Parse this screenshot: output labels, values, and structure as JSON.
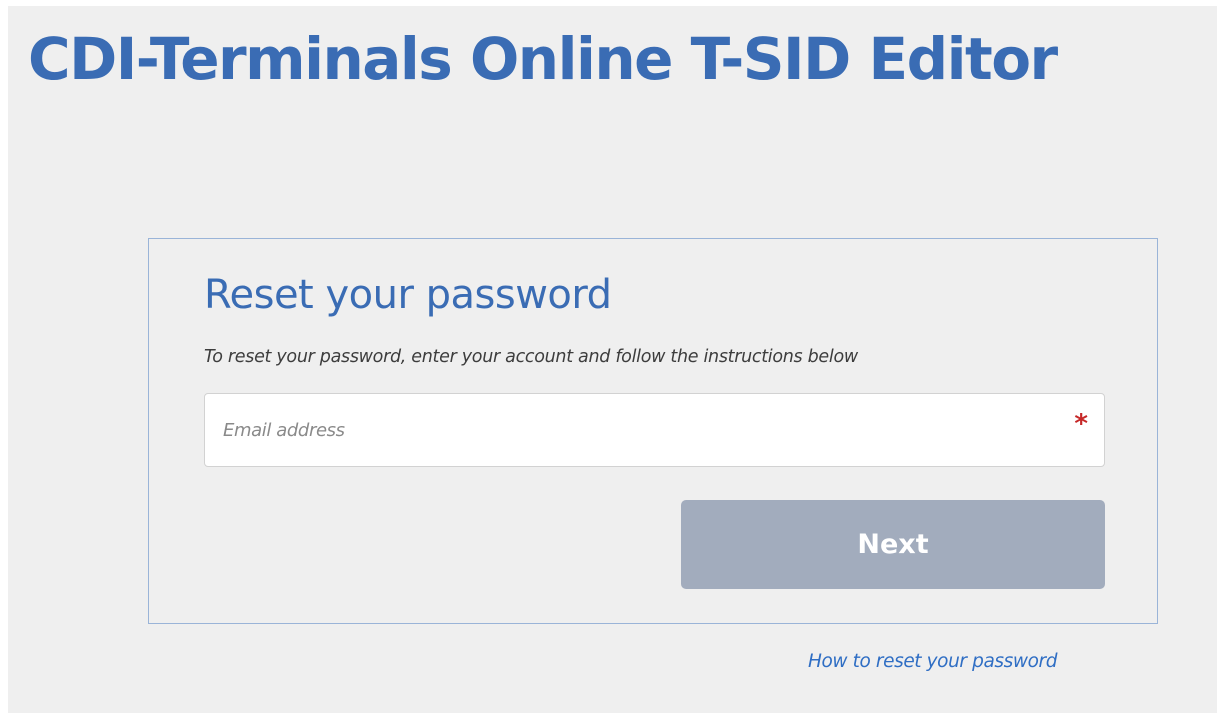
{
  "header": {
    "title": "CDI-Terminals Online T-SID Editor"
  },
  "reset_form": {
    "title": "Reset your password",
    "instructions": "To reset your password, enter your account and follow the instructions below",
    "email": {
      "placeholder": "Email address",
      "value": "",
      "required_mark": "*"
    },
    "next_label": "Next"
  },
  "footer": {
    "help_link": "How to reset your password"
  },
  "colors": {
    "page_background": "#efefef",
    "brand_blue": "#3a6cb4",
    "panel_border": "#9ab4d8",
    "button_disabled": "#a2acbd",
    "required_red": "#c62828",
    "link_blue": "#2f6ec4"
  }
}
